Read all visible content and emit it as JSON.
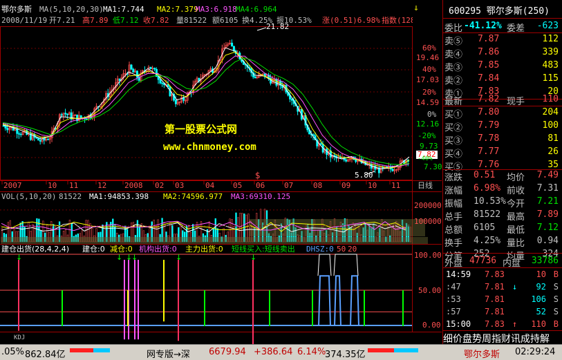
{
  "stock": {
    "name": "鄂尔多斯",
    "code_title": "600295 鄂尔多斯(250)",
    "ma_label": "MA(5,10,20,30)",
    "ma_values": [
      {
        "label": "MA1:7.744",
        "color": "#ffffff"
      },
      {
        "label": "MA2:7.379",
        "color": "#ffff00"
      },
      {
        "label": "MA3:6.918",
        "color": "#ff55ff"
      },
      {
        "label": "MA4:6.964",
        "color": "#00e000"
      }
    ],
    "info_line": {
      "date": "2008/11/19",
      "open": "开7.21",
      "high": "高7.89",
      "low": "低7.12",
      "close": "收7.82",
      "volume": "量81522",
      "amount": "额6105",
      "turnover": "换4.25%",
      "amplitude": "振10.53%",
      "change": "涨(0.51)6.98%",
      "index": "指数(128"
    },
    "peak_label": "21.82",
    "low_label": "5.80",
    "last_price_tag": "7.82",
    "y_labels": [
      "19.46",
      "17.03",
      "14.59",
      "12.16",
      "9.73",
      "7.30"
    ],
    "pct_labels": [
      "60%",
      "40%",
      "20%",
      "0%",
      "-20%",
      "-40%"
    ],
    "x_labels": [
      "2007",
      "10",
      "11",
      "12",
      "2008",
      "02",
      "03",
      "04",
      "05",
      "06",
      "07",
      "08",
      "09",
      "10",
      "11"
    ],
    "period": "日线",
    "watermark_title": "第一股票公式网",
    "watermark_url": "www.chnmoney.com",
    "arrow_icon": "⇓"
  },
  "chart_data": [
    {
      "type": "candlestick",
      "title": "",
      "x_ticks": [
        "2007",
        "10",
        "11",
        "12",
        "2008",
        "02",
        "03",
        "04",
        "05",
        "06",
        "07",
        "08",
        "09",
        "10",
        "11"
      ],
      "ylim": [
        5.0,
        23.5
      ],
      "annotations": [
        {
          "text": "21.82",
          "kind": "high"
        },
        {
          "text": "5.80",
          "kind": "low"
        }
      ],
      "series": [
        {
          "name": "close",
          "values": [
            11.5,
            11.2,
            10.6,
            10.1,
            9.6,
            10.4,
            13.2,
            12.6,
            12.4,
            12.8,
            14.2,
            15.6,
            17.0,
            18.4,
            17.2,
            18.8,
            17.4,
            15.8,
            14.1,
            15.1,
            16.9,
            17.9,
            18.7,
            21.4,
            20.6,
            18.9,
            17.3,
            17.6,
            16.7,
            16.3,
            14.4,
            12.3,
            9.9,
            8.6,
            7.7,
            7.3,
            7.9,
            7.0,
            6.5,
            6.1,
            6.3,
            6.9,
            7.82
          ]
        },
        {
          "name": "MA1:7.744",
          "values": [
            11.6,
            11.3,
            10.9,
            10.4,
            9.9,
            10.3,
            12.6,
            12.5,
            12.3,
            12.7,
            13.9,
            15.3,
            16.7,
            18.0,
            17.5,
            18.4,
            17.6,
            16.2,
            14.6,
            15.0,
            16.6,
            17.6,
            18.5,
            20.9,
            20.5,
            19.1,
            17.6,
            17.5,
            16.8,
            16.3,
            14.7,
            12.6,
            10.3,
            8.9,
            7.9,
            7.5,
            7.8,
            7.2,
            6.7,
            6.3,
            6.4,
            6.8,
            7.744
          ]
        },
        {
          "name": "MA2:7.379",
          "values": [
            11.7,
            11.4,
            11.1,
            10.6,
            10.1,
            10.2,
            11.9,
            12.4,
            12.4,
            12.6,
            13.4,
            14.7,
            16.1,
            17.5,
            17.6,
            18.1,
            17.7,
            16.7,
            15.3,
            15.0,
            16.0,
            17.1,
            18.1,
            20.0,
            20.4,
            19.5,
            18.1,
            17.5,
            17.0,
            16.5,
            15.2,
            13.4,
            11.1,
            9.4,
            8.3,
            7.7,
            7.6,
            7.3,
            6.9,
            6.6,
            6.4,
            6.6,
            7.379
          ]
        },
        {
          "name": "MA3:6.918",
          "values": [
            11.8,
            11.6,
            11.3,
            10.9,
            10.4,
            10.2,
            11.1,
            12.0,
            12.3,
            12.5,
            13.0,
            14.0,
            15.3,
            16.7,
            17.3,
            17.8,
            17.8,
            17.2,
            16.1,
            15.4,
            15.6,
            16.5,
            17.4,
            19.0,
            19.9,
            19.9,
            18.9,
            17.9,
            17.2,
            16.8,
            15.9,
            14.4,
            12.4,
            10.4,
            9.1,
            8.2,
            7.7,
            7.4,
            7.1,
            6.8,
            6.6,
            6.6,
            6.918
          ]
        },
        {
          "name": "MA4:6.964",
          "values": [
            11.9,
            11.7,
            11.5,
            11.2,
            10.8,
            10.4,
            10.8,
            11.5,
            12.0,
            12.3,
            12.7,
            13.4,
            14.5,
            15.8,
            16.7,
            17.3,
            17.6,
            17.4,
            16.7,
            16.0,
            15.8,
            16.1,
            16.9,
            18.2,
            19.2,
            19.7,
            19.3,
            18.5,
            17.7,
            17.2,
            16.5,
            15.3,
            13.6,
            11.7,
            10.1,
            9.0,
            8.3,
            7.8,
            7.4,
            7.1,
            6.9,
            6.8,
            6.964
          ]
        }
      ]
    },
    {
      "type": "bar",
      "title": "VOL(5,10,20) 81522",
      "ylim": [
        0,
        260000
      ],
      "y_ticks": [
        200000,
        100000
      ],
      "series": [
        {
          "name": "MA1:94853.398",
          "values": [
            94853.398
          ]
        },
        {
          "name": "MA2:74596.977",
          "values": [
            74596.977
          ]
        },
        {
          "name": "MA3:69310.125",
          "values": [
            69310.125
          ]
        }
      ]
    },
    {
      "type": "line",
      "title": "建仓出货(28,4,2,4)",
      "ylim": [
        0,
        100
      ],
      "y_ticks": [
        100,
        50,
        0
      ],
      "series": [
        {
          "name": "建仓:0",
          "values": [
            0
          ]
        },
        {
          "name": "减仓:0",
          "values": [
            0
          ]
        },
        {
          "name": "机构出货:0",
          "values": [
            0
          ]
        },
        {
          "name": "主力出货:0",
          "values": [
            0
          ]
        },
        {
          "name": "短线买入:短线卖出",
          "values": [
            0
          ]
        },
        {
          "name": "DHSZ:0",
          "values": [
            0
          ]
        },
        {
          "name": "50",
          "values": [
            50
          ]
        },
        {
          "name": "20",
          "values": [
            20
          ]
        }
      ]
    }
  ],
  "vol_indicator": {
    "label": "VOL(5,10,20)",
    "value": "81522",
    "ma1": "MA1:94853.398",
    "ma2": "MA2:74596.977",
    "ma3": "MA3:69310.125",
    "y_labels": [
      "200000",
      "100000"
    ]
  },
  "lower_indicator": {
    "label": "建仓出货(28,4,2,4)",
    "jc": "建仓:0",
    "jiancang": "减仓:0",
    "jgch": "机构出货:0",
    "zlch": "主力出货:0",
    "dxmr": "短线买入:短线卖出",
    "dhsz": "DHSZ:0",
    "v50": "50",
    "v20": "20",
    "y_labels": [
      "100.00",
      "50.00",
      "0.00"
    ],
    "bottom_tab": "KDJ"
  },
  "quote": {
    "weibi_label": "委比",
    "weibi": "-41.12%",
    "weicha_label": "委差",
    "weicha": "-623",
    "asks": [
      {
        "label": "卖⑤",
        "price": "7.87",
        "vol": "112"
      },
      {
        "label": "卖④",
        "price": "7.86",
        "vol": "339"
      },
      {
        "label": "卖③",
        "price": "7.85",
        "vol": "483"
      },
      {
        "label": "卖②",
        "price": "7.84",
        "vol": "115"
      },
      {
        "label": "卖①",
        "price": "7.83",
        "vol": "20"
      }
    ],
    "last_label": "最新",
    "last": "7.82",
    "xianshou_label": "现手",
    "xianshou": "110",
    "bids": [
      {
        "label": "买①",
        "price": "7.80",
        "vol": "204"
      },
      {
        "label": "买②",
        "price": "7.79",
        "vol": "100"
      },
      {
        "label": "买③",
        "price": "7.78",
        "vol": "81"
      },
      {
        "label": "买④",
        "price": "7.77",
        "vol": "26"
      },
      {
        "label": "买⑤",
        "price": "7.76",
        "vol": "35"
      }
    ],
    "stats": [
      {
        "l1": "涨跌",
        "v1": "0.51",
        "l2": "均价",
        "v2": "7.49",
        "c1": "#ff5050",
        "c2": "#ff5050"
      },
      {
        "l1": "涨幅",
        "v1": "6.98%",
        "l2": "前收",
        "v2": "7.31",
        "c1": "#ff5050",
        "c2": "#c0c0c0"
      },
      {
        "l1": "振幅",
        "v1": "10.53%",
        "l2": "今开",
        "v2": "7.21",
        "c1": "#c0c0c0",
        "c2": "#00e000"
      },
      {
        "l1": "总手",
        "v1": "81522",
        "l2": "最高",
        "v2": "7.89",
        "c1": "#c0c0c0",
        "c2": "#ff5050"
      },
      {
        "l1": "总额",
        "v1": "6105",
        "l2": "最低",
        "v2": "7.12",
        "c1": "#c0c0c0",
        "c2": "#00e000"
      },
      {
        "l1": "换手",
        "v1": "4.25%",
        "l2": "量比",
        "v2": "0.94",
        "c1": "#c0c0c0",
        "c2": "#c0c0c0"
      },
      {
        "l1": "分笔",
        "v1": "252",
        "l2": "均量",
        "v2": "324",
        "c1": "#c0c0c0",
        "c2": "#c0c0c0"
      }
    ],
    "waipan_label": "外盘",
    "waipan": "47736",
    "neipan_label": "内盘",
    "neipan": "33786",
    "ticks": [
      {
        "t": "14:59",
        "p": "7.83",
        "arrow": "",
        "v": "10",
        "s": "B",
        "tc": "#ffffff",
        "pc": "#ff5050",
        "vc": "#ff5050"
      },
      {
        "t": ":47",
        "p": "7.81",
        "arrow": "↓",
        "v": "92",
        "s": "S",
        "tc": "#c0c0c0",
        "pc": "#ff5050",
        "vc": "#00ffff"
      },
      {
        "t": ":53",
        "p": "7.81",
        "arrow": "",
        "v": "106",
        "s": "S",
        "tc": "#c0c0c0",
        "pc": "#ff5050",
        "vc": "#00ffff"
      },
      {
        "t": ":57",
        "p": "7.81",
        "arrow": "",
        "v": "52",
        "s": "S",
        "tc": "#c0c0c0",
        "pc": "#ff5050",
        "vc": "#00ffff"
      },
      {
        "t": "15:00",
        "p": "7.83",
        "arrow": "↑",
        "v": "110",
        "s": "B",
        "tc": "#ffffff",
        "pc": "#ff5050",
        "vc": "#ff5050"
      }
    ],
    "bottom_tabs": "细价盘势周指财讯成持解"
  },
  "statusbar": {
    "left_pct": ".05%",
    "left_amt": "862.84亿",
    "center_label": "网专版→深",
    "sz_index": "6679.94",
    "sz_change": "+386.64",
    "sz_pct": "6.14%",
    "sz_amt": "374.35亿",
    "stock_name": "鄂尔多斯",
    "clock": "02:29:24"
  },
  "colors": {
    "up": "#ff5050",
    "down": "#00e000",
    "grid": "#a00000",
    "bg": "#000000"
  }
}
